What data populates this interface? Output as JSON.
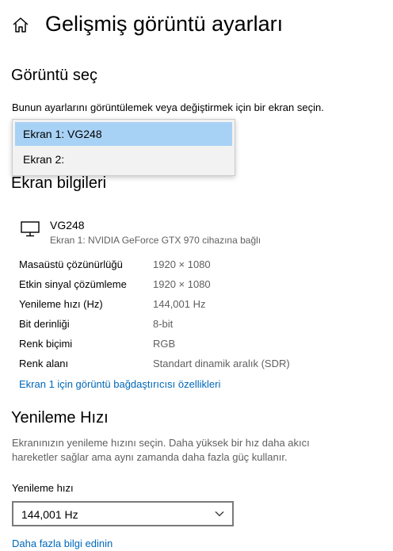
{
  "header": {
    "title": "Gelişmiş görüntü ayarları"
  },
  "select_display": {
    "title": "Görüntü seç",
    "description": "Bunun ayarlarını görüntülemek veya değiştirmek için bir ekran seçin.",
    "options": [
      "Ekran 1: VG248",
      "Ekran 2:"
    ],
    "selected_index": 0
  },
  "display_info": {
    "title": "Ekran bilgileri",
    "monitor_name": "VG248",
    "monitor_subtitle": "Ekran 1: NVIDIA GeForce GTX 970 cihazına bağlı",
    "rows": [
      {
        "label": "Masaüstü çözünürlüğü",
        "value": "1920 × 1080"
      },
      {
        "label": "Etkin sinyal çözümleme",
        "value": "1920 × 1080"
      },
      {
        "label": "Yenileme hızı (Hz)",
        "value": "144,001 Hz"
      },
      {
        "label": "Bit derinliği",
        "value": "8-bit"
      },
      {
        "label": "Renk biçimi",
        "value": "RGB"
      },
      {
        "label": "Renk alanı",
        "value": "Standart dinamik aralık (SDR)"
      }
    ],
    "adapter_link": "Ekran 1 için görüntü bağdaştırıcısı özellikleri"
  },
  "refresh_rate": {
    "title": "Yenileme Hızı",
    "description_line1": "Ekranınızın yenileme hızını seçin. Daha yüksek bir hız daha akıcı",
    "description_line2": "hareketler sağlar ama aynı zamanda daha fazla güç kullanır.",
    "field_label": "Yenileme hızı",
    "selected_value": "144,001 Hz",
    "more_info_link": "Daha fazla bilgi edinin"
  },
  "colors": {
    "accent": "#0067b8",
    "selection": "#a8d2f5",
    "muted_text": "#5f5f5f"
  },
  "icons": {
    "home": "home-icon",
    "monitor": "monitor-icon",
    "chevron": "chevron-down-icon"
  }
}
